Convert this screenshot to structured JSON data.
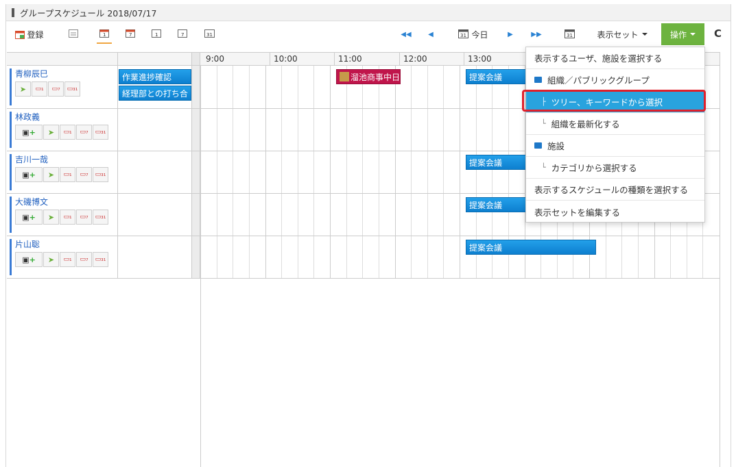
{
  "title": "グループスケジュール 2018/07/17",
  "toolbar": {
    "register_label": "登録",
    "today_label": "今日",
    "display_set_label": "表示セット",
    "operation_label": "操作",
    "cal31": "31",
    "today_cal": "31",
    "refresh_icon": "C"
  },
  "hours": [
    "9:00",
    "10:00",
    "11:00",
    "12:00",
    "13:00"
  ],
  "users": [
    {
      "name": "青柳辰巳",
      "allday": [
        "作業進捗確認",
        "経理部との打ち合"
      ],
      "events": [
        "溜池商事中日",
        "提案会議"
      ]
    },
    {
      "name": "林政義",
      "allday": [],
      "events": []
    },
    {
      "name": "吉川一哉",
      "allday": [],
      "events": [
        "提案会議"
      ]
    },
    {
      "name": "大磯博文",
      "allday": [],
      "events": [
        "提案会議"
      ]
    },
    {
      "name": "片山聡",
      "allday": [],
      "events": [
        "提案会議"
      ]
    }
  ],
  "menu": {
    "items": [
      "表示するユーザ、施設を選択する",
      "組織／パブリックグループ",
      "ツリー、キーワードから選択",
      "組織を最新化する",
      "施設",
      "カテゴリから選択する",
      "表示するスケジュールの種類を選択する",
      "表示セットを編集する"
    ],
    "selected_index": 2
  },
  "colors": {
    "event_blue": "#1891e0",
    "event_red": "#c0154b",
    "operation_green": "#6db33f",
    "selected_menu": "#29a3de",
    "highlight_red": "#e0202b",
    "link_blue": "#1f5fbf"
  }
}
